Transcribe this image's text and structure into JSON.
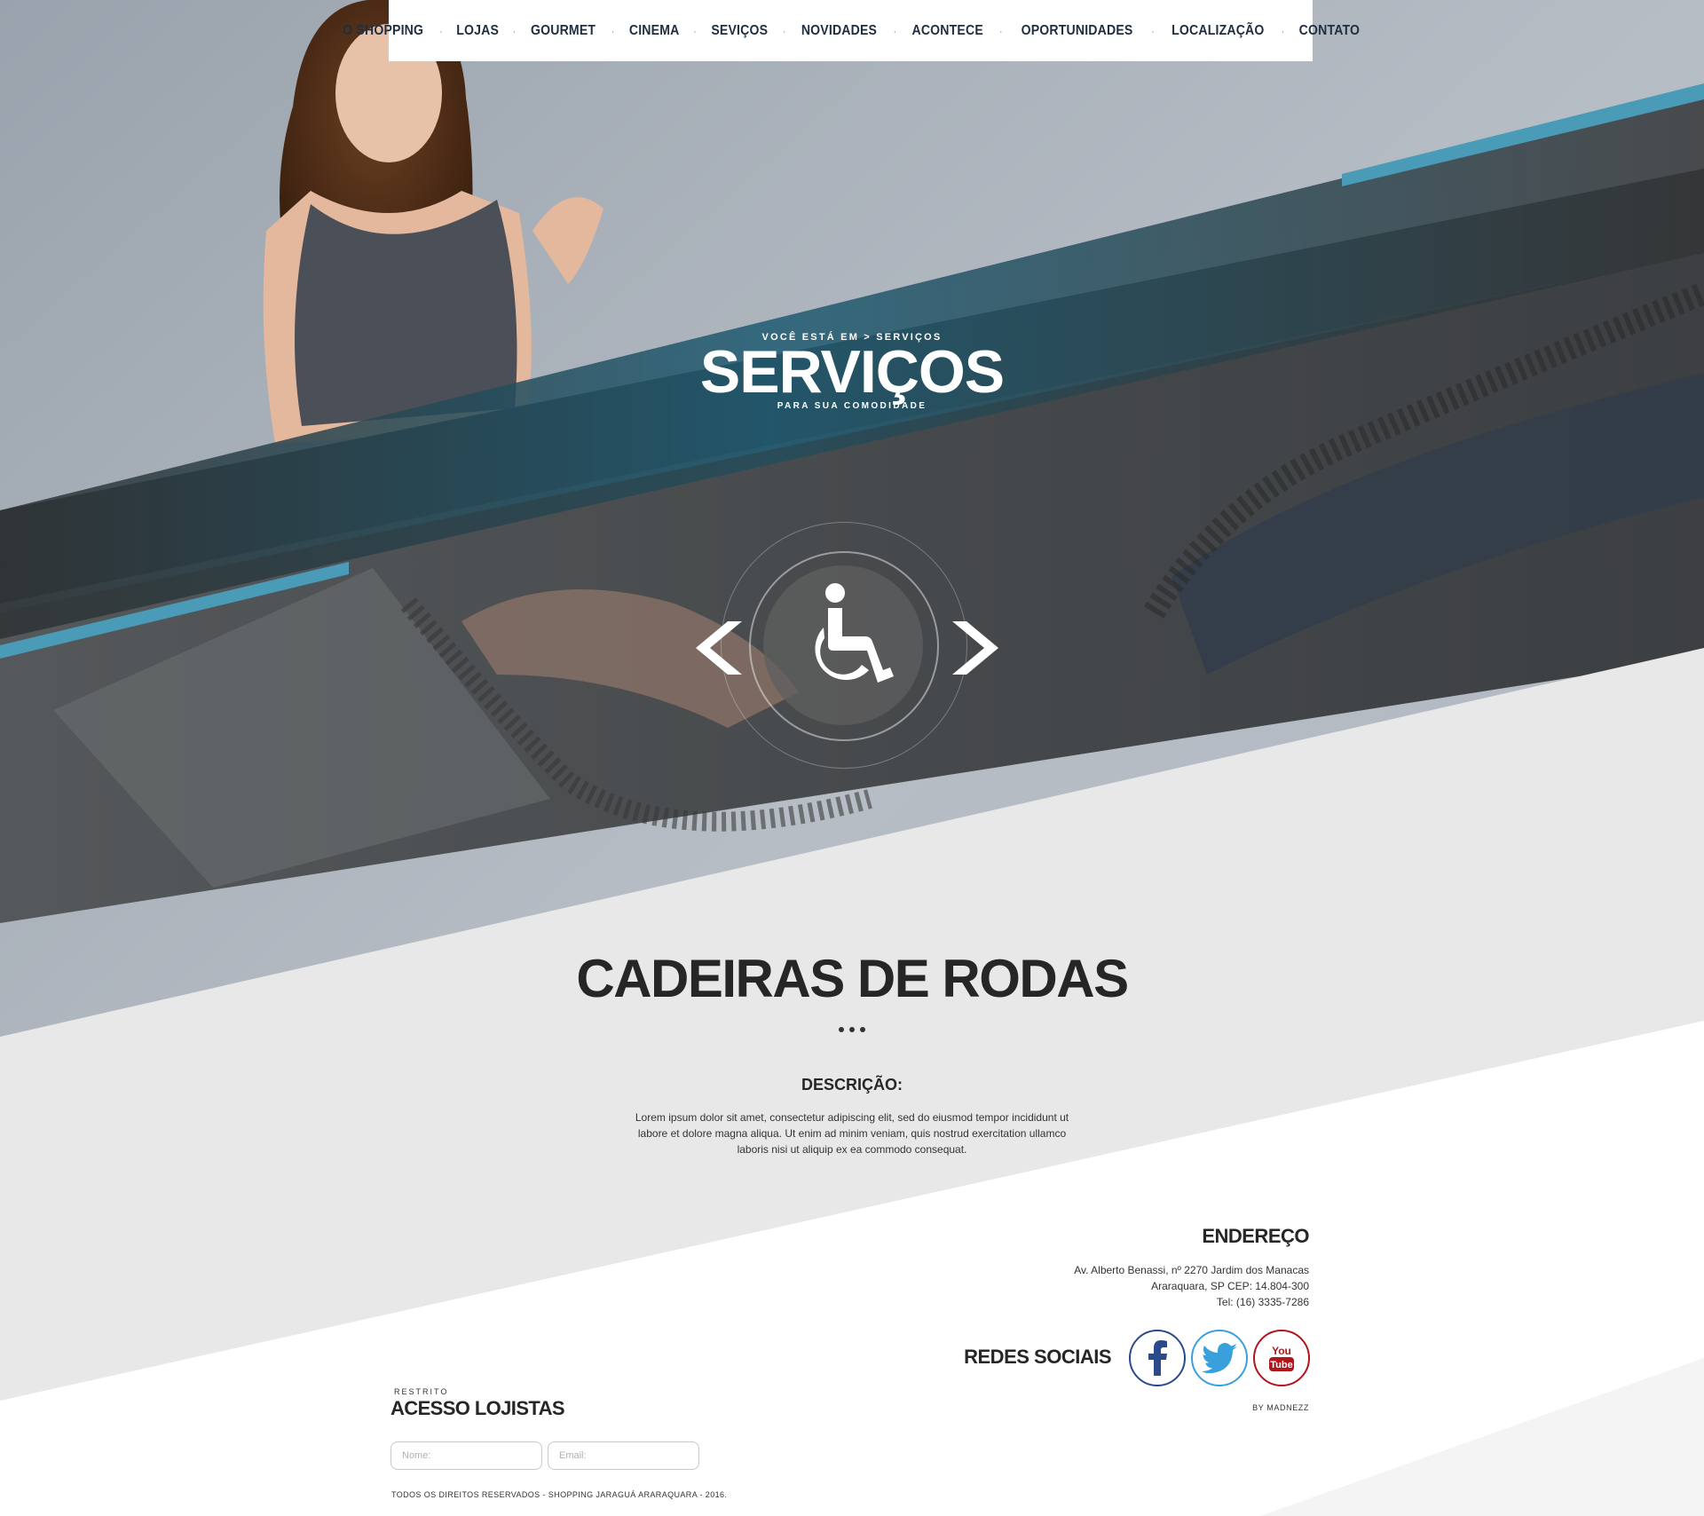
{
  "nav": {
    "items": [
      {
        "label": "O SHOPPING"
      },
      {
        "label": "LOJAS"
      },
      {
        "label": "GOURMET"
      },
      {
        "label": "CINEMA"
      },
      {
        "label": "SEVIÇOS"
      },
      {
        "label": "NOVIDADES"
      },
      {
        "label": "ACONTECE"
      },
      {
        "label": "OPORTUNIDADES"
      },
      {
        "label": "LOCALIZAÇÃO"
      },
      {
        "label": "CONTATO"
      }
    ],
    "separator": "·"
  },
  "hero": {
    "breadcrumb": "VOCÊ ESTÁ EM > SERVIÇOS",
    "title": "SERVIÇOS",
    "subtitle": "PARA SUA COMODIDADE",
    "slide_icon": "wheelchair-icon"
  },
  "service": {
    "title": "CADEIRAS DE RODAS",
    "description_label": "DESCRIÇÃO:",
    "description": "Lorem ipsum dolor sit amet, consectetur adipiscing elit, sed do eiusmod tempor incididunt ut labore et dolore magna aliqua. Ut enim ad minim veniam, quis nostrud exercitation ullamco laboris nisi ut aliquip ex ea commodo consequat."
  },
  "address": {
    "title": "ENDEREÇO",
    "line1": "Av. Alberto Benassi, nº 2270 Jardim dos Manacas",
    "line2": "Araraquara, SP CEP: 14.804-300",
    "line3": "Tel: (16) 3335-7286"
  },
  "social": {
    "title": "REDES SOCIAIS",
    "facebook_icon": "facebook-icon",
    "twitter_icon": "twitter-icon",
    "youtube_icon": "youtube-icon",
    "youtube_you": "You",
    "youtube_tube": "Tube"
  },
  "credit": "BY MADNEZZ",
  "login": {
    "kicker": "RESTRITO",
    "title": "ACESSO LOJISTAS",
    "name_placeholder": "Nome:",
    "email_placeholder": "Email:"
  },
  "copyright": "TODOS OS DIREITOS RESERVADOS - SHOPPING JARAGUÁ ARARAQUARA - 2016.",
  "colors": {
    "accent": "#4a9bb8",
    "dark_band": "#353637",
    "teal": "#1e5b72",
    "facebook": "#2a4a8c",
    "twitter": "#3aa0dc",
    "youtube": "#b0151c"
  }
}
